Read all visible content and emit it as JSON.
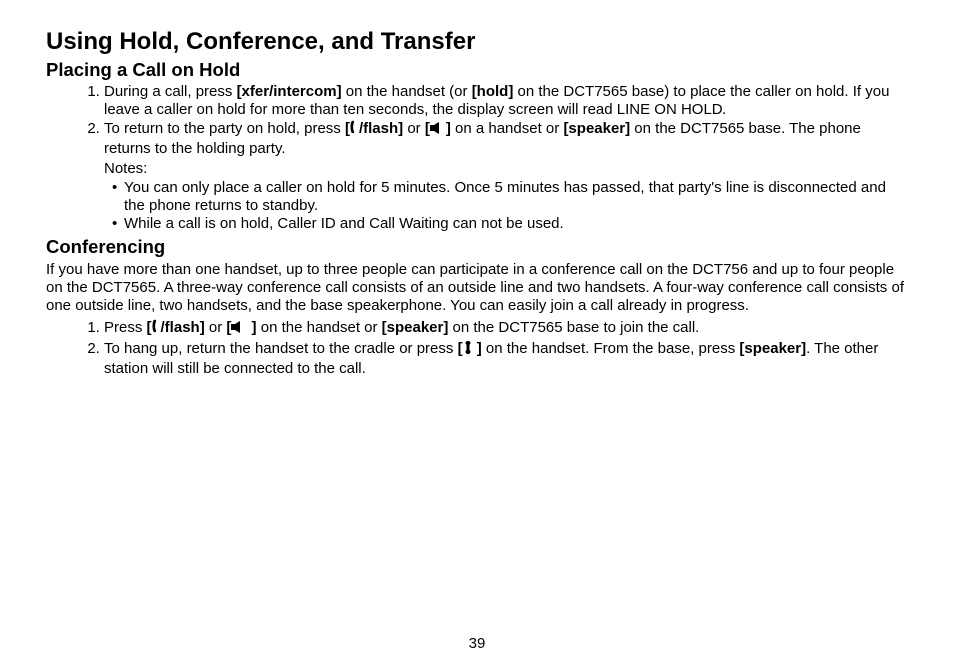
{
  "page_number": "39",
  "h1": "Using Hold, Conference, and Transfer",
  "placing": {
    "heading": "Placing a Call on Hold",
    "step1_a": "During a call, press ",
    "step1_b": "[xfer/intercom]",
    "step1_c": " on the handset (or ",
    "step1_d": "[hold]",
    "step1_e": " on the DCT7565 base) to place the caller on hold. If you leave a caller on hold for more than ten seconds, the display screen will read LINE ON HOLD",
    "step1_f": ".",
    "step2_a": "To return to the party on hold, press ",
    "step2_b": "[",
    "step2_c": "/flash]",
    "step2_d": " or ",
    "step2_e": "[",
    "step2_f": "]",
    "step2_g": " on a handset or ",
    "step2_h": "[speaker]",
    "step2_i": " on the DCT7565 base. The phone returns to the holding party.",
    "notes_label": "Notes:",
    "note1": "You can only place a caller on hold for 5 minutes. Once 5 minutes has passed, that party's line is disconnected and the phone returns to standby.",
    "note2": "While a call is on hold, Caller ID and Call Waiting can not be used."
  },
  "conferencing": {
    "heading": "Conferencing",
    "para": "If you have more than one handset, up to three people can participate in a conference call on the DCT756 and up to four people on the DCT7565. A three-way conference call consists of an outside line and two handsets. A four-way conference call consists of one outside line, two handsets, and the base speakerphone. You can easily join a call already in progress.",
    "step1_a": "Press ",
    "step1_b": "[",
    "step1_c": "/flash]",
    "step1_d": " or ",
    "step1_e": "[",
    "step1_f": " ]",
    "step1_g": " on the handset or ",
    "step1_h": "[speaker]",
    "step1_i": " on the DCT7565 base to join the call.",
    "step2_a": "To hang up, return the handset to the cradle or press ",
    "step2_b": "[",
    "step2_c": " ]",
    "step2_d": " on the handset. From the base, press ",
    "step2_e": "[speaker]",
    "step2_f": ". The other station will still be connected to the call."
  }
}
